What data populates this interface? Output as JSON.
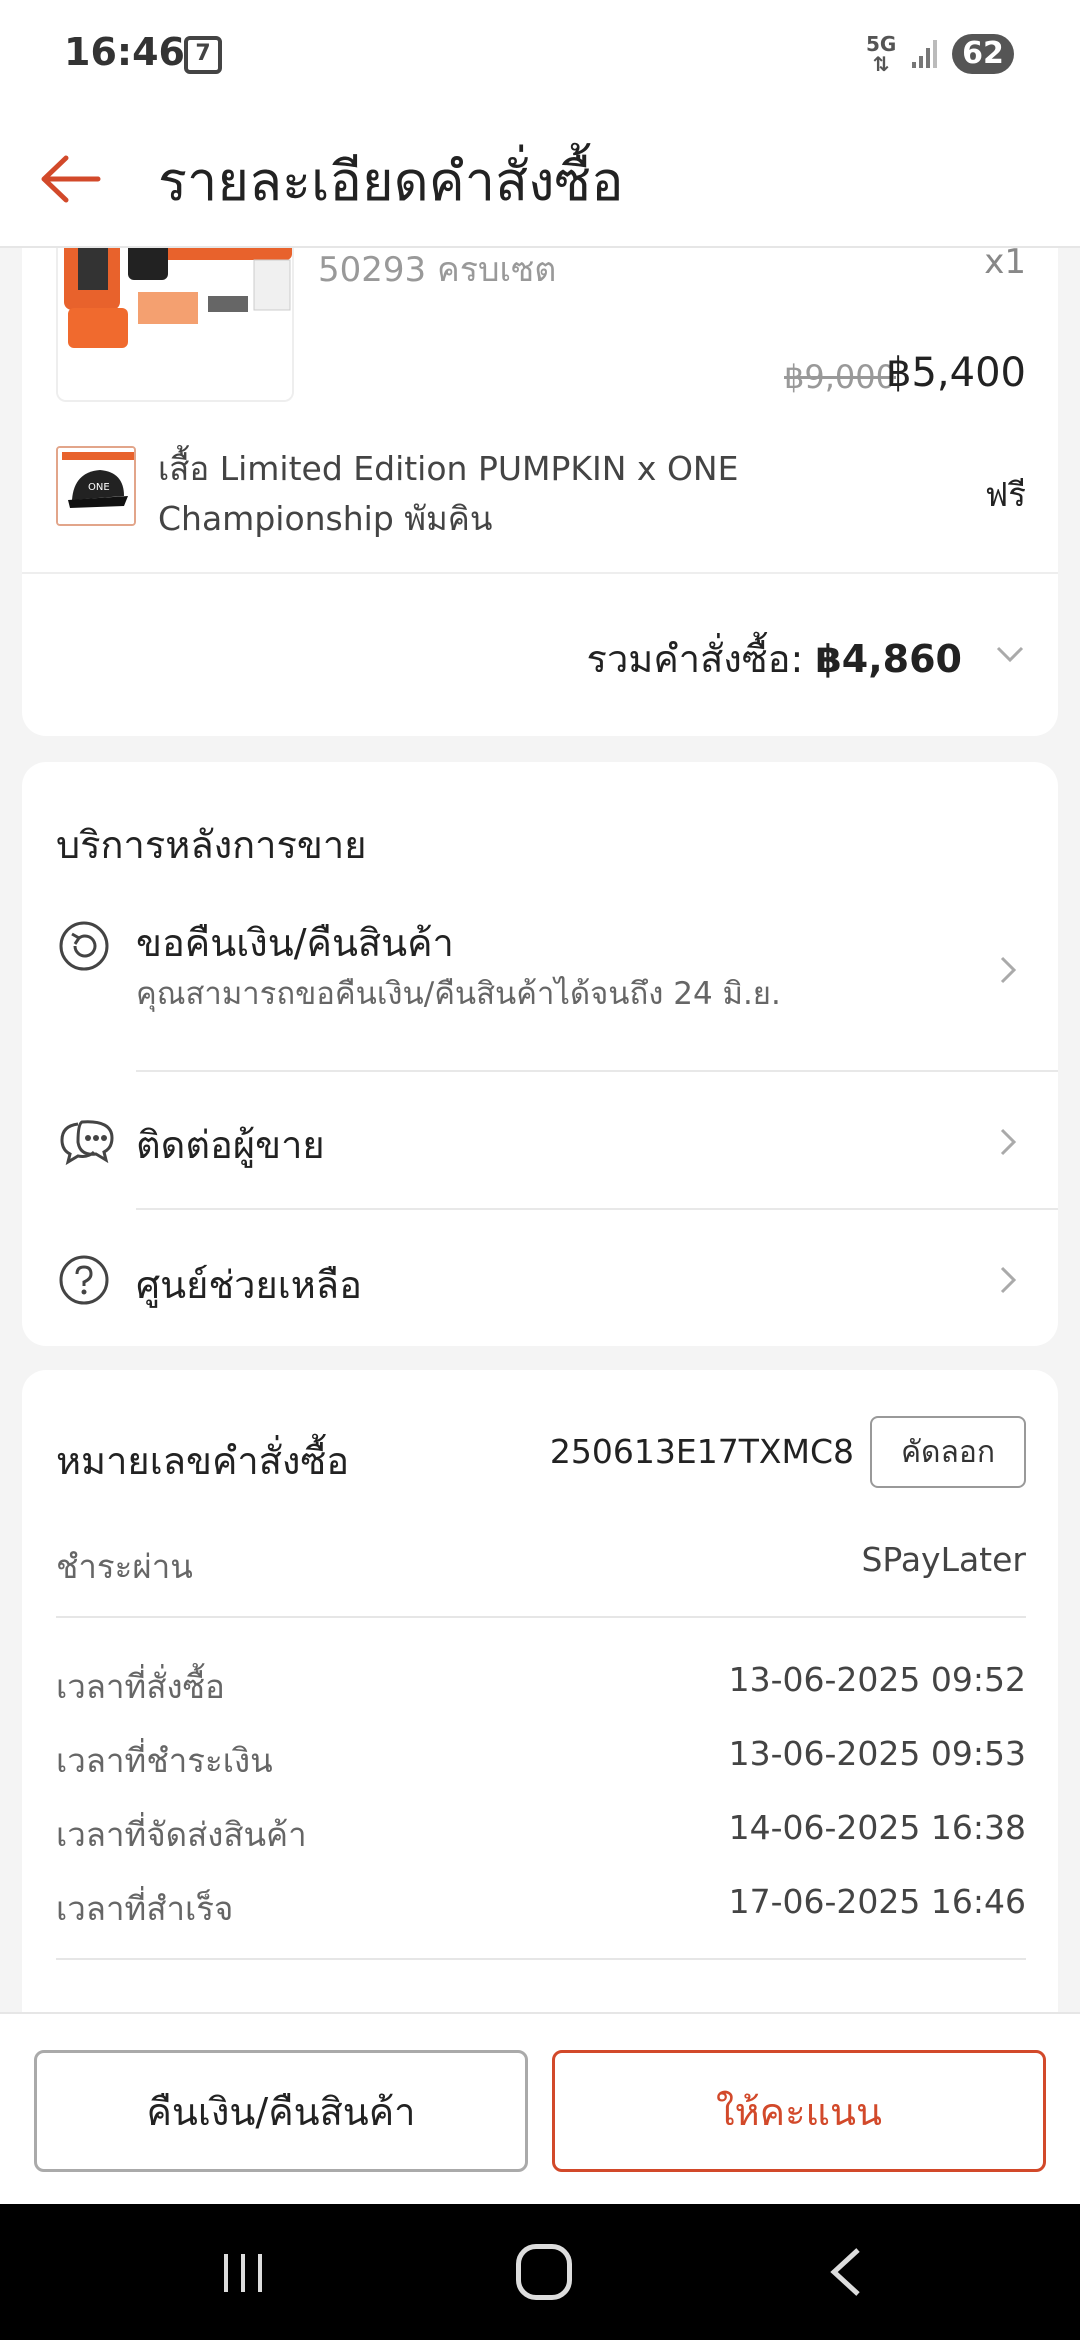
{
  "status_bar": {
    "time": "16:46",
    "store_icon_text": "7",
    "network": "5G",
    "battery": "62"
  },
  "header": {
    "title": "รายละเอียดคำสั่งซื้อ"
  },
  "product": {
    "variant": "50293 ครบเซต",
    "quantity": "x1",
    "price_original": "฿9,000",
    "price": "฿5,400"
  },
  "gift": {
    "name": "เสื้อ Limited Edition PUMPKIN x ONE Championship พัมคิน",
    "price": "ฟรี"
  },
  "order_total": {
    "label": "รวมคำสั่งซื้อ: ",
    "amount": "฿4,860"
  },
  "after_sales": {
    "title": "บริการหลังการขาย",
    "items": [
      {
        "label": "ขอคืนเงิน/คืนสินค้า",
        "sub": "คุณสามารถขอคืนเงิน/คืนสินค้าได้จนถึง 24 มิ.ย."
      },
      {
        "label": "ติดต่อผู้ขาย"
      },
      {
        "label": "ศูนย์ช่วยเหลือ"
      }
    ]
  },
  "order_info": {
    "number_label": "หมายเลขคำสั่งซื้อ",
    "number": "250613E17TXMC8",
    "copy_label": "คัดลอก",
    "pay_label": "ชำระผ่าน",
    "pay_value": "SPayLater",
    "times": [
      {
        "label": "เวลาที่สั่งซื้อ",
        "value": "13-06-2025 09:52"
      },
      {
        "label": "เวลาที่ชำระเงิน",
        "value": "13-06-2025 09:53"
      },
      {
        "label": "เวลาที่จัดส่งสินค้า",
        "value": "14-06-2025 16:38"
      },
      {
        "label": "เวลาที่สำเร็จ",
        "value": "17-06-2025 16:46"
      }
    ]
  },
  "actions": {
    "refund": "คืนเงิน/คืนสินค้า",
    "rate": "ให้คะแนน"
  },
  "colors": {
    "accent": "#d2492a",
    "background": "#f4f4f4"
  }
}
